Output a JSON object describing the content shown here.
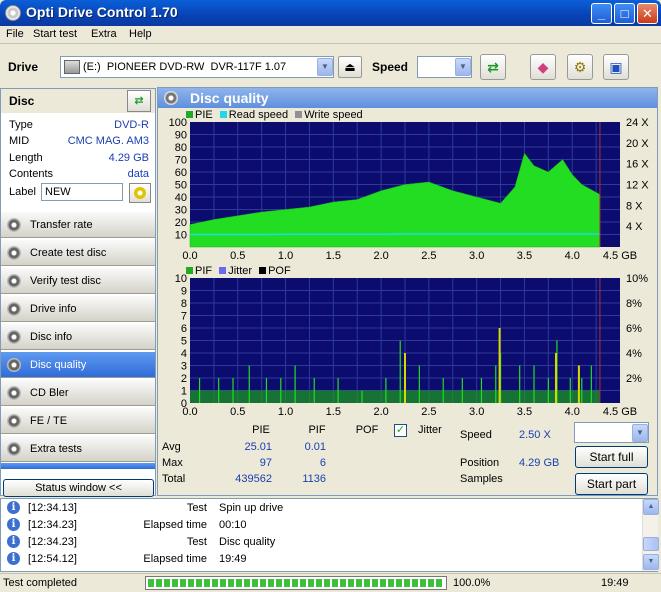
{
  "window": {
    "title": "Opti Drive Control 1.70"
  },
  "menu": [
    "File",
    "Start test",
    "Extra",
    "Help"
  ],
  "toolbar": {
    "drive_label": "Drive",
    "drive_value": "(E:)  PIONEER DVD-RW  DVR-117F 1.07",
    "speed_label": "Speed",
    "speed_value": ""
  },
  "disc": {
    "title": "Disc",
    "rows": [
      {
        "key": "Type",
        "value": "DVD-R"
      },
      {
        "key": "MID",
        "value": "CMC MAG. AM3"
      },
      {
        "key": "Length",
        "value": "4.29 GB"
      },
      {
        "key": "Contents",
        "value": "data"
      }
    ],
    "label_key": "Label",
    "label_value": "NEW"
  },
  "nav": [
    {
      "label": "Transfer rate",
      "active": false
    },
    {
      "label": "Create test disc",
      "active": false
    },
    {
      "label": "Verify test disc",
      "active": false
    },
    {
      "label": "Drive info",
      "active": false
    },
    {
      "label": "Disc info",
      "active": false
    },
    {
      "label": "Disc quality",
      "active": true
    },
    {
      "label": "CD Bler",
      "active": false
    },
    {
      "label": "FE / TE",
      "active": false
    },
    {
      "label": "Extra tests",
      "active": false
    }
  ],
  "status_window_btn": "Status window <<",
  "panel_title": "Disc quality",
  "chart_data": [
    {
      "type": "area",
      "legend": [
        "PIE",
        "Read speed",
        "Write speed"
      ],
      "colors": {
        "pie": "#22dd22",
        "read": "#22d8e8",
        "write": "#909090",
        "bg": "#0b0c6e",
        "grid": "#2d3a9a"
      },
      "x_ticks": [
        "0.0",
        "0.5",
        "1.0",
        "1.5",
        "2.0",
        "2.5",
        "3.0",
        "3.5",
        "4.0",
        "4.5 GB"
      ],
      "xlim": [
        0,
        4.5
      ],
      "y_ticks": [
        "10",
        "20",
        "30",
        "40",
        "50",
        "60",
        "70",
        "80",
        "90",
        "100"
      ],
      "ylim": [
        0,
        100
      ],
      "y2_ticks": [
        "4 X",
        "8 X",
        "12 X",
        "16 X",
        "20 X",
        "24 X"
      ],
      "y2lim": [
        0,
        24
      ],
      "x": [
        0.0,
        0.25,
        0.5,
        0.75,
        1.0,
        1.25,
        1.5,
        1.75,
        2.0,
        2.25,
        2.5,
        2.75,
        3.0,
        3.25,
        3.4,
        3.5,
        3.6,
        3.75,
        3.9,
        4.0,
        4.1,
        4.29
      ],
      "pie": [
        18,
        22,
        25,
        28,
        30,
        32,
        36,
        38,
        45,
        50,
        52,
        45,
        40,
        35,
        48,
        75,
        65,
        60,
        70,
        58,
        50,
        42
      ],
      "read_speed_x": [
        2.4,
        2.4,
        2.4,
        2.4,
        2.45,
        2.45,
        2.45,
        2.45,
        2.45,
        2.5,
        2.5,
        2.5,
        2.5,
        2.5,
        2.5,
        2.5,
        2.5,
        2.5,
        2.5,
        2.5,
        2.5,
        2.5
      ]
    },
    {
      "type": "bar",
      "legend": [
        "PIF",
        "Jitter",
        "POF"
      ],
      "colors": {
        "pif": "#22dd22",
        "pif_high": "#d8d800",
        "jitter": "#6a6af0",
        "pof": "#000000",
        "bg": "#0b0c6e",
        "grid": "#2d3a9a"
      },
      "x_ticks": [
        "0.0",
        "0.5",
        "1.0",
        "1.5",
        "2.0",
        "2.5",
        "3.0",
        "3.5",
        "4.0",
        "4.5 GB"
      ],
      "xlim": [
        0,
        4.5
      ],
      "y_ticks": [
        "0",
        "1",
        "2",
        "3",
        "4",
        "5",
        "6",
        "7",
        "8",
        "9",
        "10"
      ],
      "ylim": [
        0,
        10
      ],
      "y2_ticks": [
        "2%",
        "4%",
        "6%",
        "8%",
        "10%"
      ],
      "y2lim": [
        0,
        10
      ],
      "spikes": [
        {
          "x": 0.1,
          "v": 2
        },
        {
          "x": 0.3,
          "v": 2
        },
        {
          "x": 0.45,
          "v": 2
        },
        {
          "x": 0.62,
          "v": 3
        },
        {
          "x": 0.8,
          "v": 2
        },
        {
          "x": 0.95,
          "v": 2
        },
        {
          "x": 1.1,
          "v": 3
        },
        {
          "x": 1.3,
          "v": 2
        },
        {
          "x": 1.55,
          "v": 2
        },
        {
          "x": 1.8,
          "v": 1
        },
        {
          "x": 2.05,
          "v": 2
        },
        {
          "x": 2.2,
          "v": 5
        },
        {
          "x": 2.4,
          "v": 3
        },
        {
          "x": 2.65,
          "v": 2
        },
        {
          "x": 2.85,
          "v": 2
        },
        {
          "x": 3.05,
          "v": 2
        },
        {
          "x": 3.2,
          "v": 3
        },
        {
          "x": 3.25,
          "v": 4
        },
        {
          "x": 3.45,
          "v": 3
        },
        {
          "x": 3.6,
          "v": 3
        },
        {
          "x": 3.75,
          "v": 2
        },
        {
          "x": 3.84,
          "v": 5
        },
        {
          "x": 3.98,
          "v": 2
        },
        {
          "x": 4.1,
          "v": 2
        },
        {
          "x": 4.2,
          "v": 3
        }
      ],
      "high_spikes": [
        {
          "x": 2.25,
          "v": 4
        },
        {
          "x": 3.24,
          "v": 6
        },
        {
          "x": 3.83,
          "v": 4
        },
        {
          "x": 4.07,
          "v": 3
        }
      ]
    }
  ],
  "stats": {
    "headers": [
      "PIE",
      "PIF",
      "POF"
    ],
    "jitter_label": "Jitter",
    "jitter_checked": true,
    "rows": [
      {
        "label": "Avg",
        "pie": "25.01",
        "pif": "0.01"
      },
      {
        "label": "Max",
        "pie": "97",
        "pif": "6"
      },
      {
        "label": "Total",
        "pie": "439562",
        "pif": "1136"
      }
    ],
    "speed_label": "Speed",
    "speed_value": "2.50 X",
    "position_label": "Position",
    "position_value": "4.29 GB",
    "samples_label": "Samples",
    "start_full": "Start full",
    "start_part": "Start part"
  },
  "log": [
    {
      "time": "[12:34.13]",
      "label": "Test",
      "value": "Spin up drive"
    },
    {
      "time": "[12:34.23]",
      "label": "Elapsed time",
      "value": "00:10"
    },
    {
      "time": "[12:34.23]",
      "label": "Test",
      "value": "Disc quality"
    },
    {
      "time": "[12:54.12]",
      "label": "Elapsed time",
      "value": "19:49"
    }
  ],
  "statusbar": {
    "text": "Test completed",
    "progress_fraction": 1.0,
    "progress_text": "100.0%",
    "time": "19:49"
  }
}
